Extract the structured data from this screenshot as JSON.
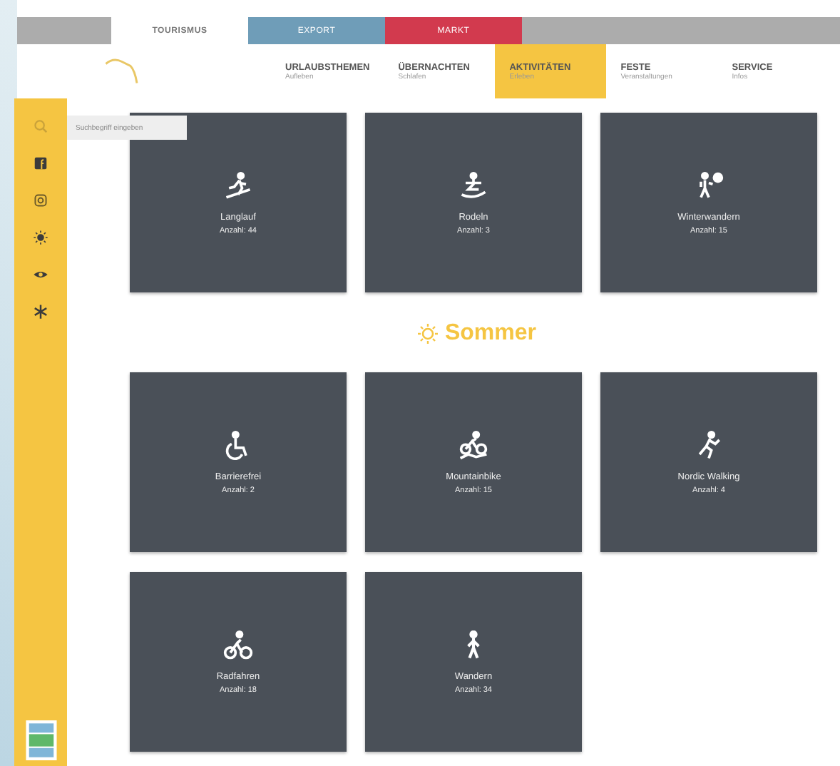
{
  "top_tabs": [
    {
      "label": "TOURISMUS",
      "selected": true,
      "color": "#ffffff"
    },
    {
      "label": "EXPORT",
      "selected": false,
      "color": "#6f9db8"
    },
    {
      "label": "MARKT",
      "selected": false,
      "color": "#d23a4e"
    }
  ],
  "nav": [
    {
      "label": "URLAUBSTHEMEN",
      "sub": "Aufleben",
      "selected": false
    },
    {
      "label": "ÜBERNACHTEN",
      "sub": "Schlafen",
      "selected": false
    },
    {
      "label": "AKTIVITÄTEN",
      "sub": "Erleben",
      "selected": true
    },
    {
      "label": "FESTE",
      "sub": "Veranstaltungen",
      "selected": false
    },
    {
      "label": "SERVICE",
      "sub": "Infos",
      "selected": false
    }
  ],
  "sidebar": [
    {
      "kind": "search"
    },
    {
      "kind": "facebook"
    },
    {
      "kind": "instagram"
    },
    {
      "kind": "sun"
    },
    {
      "kind": "eye"
    },
    {
      "kind": "snowflake"
    }
  ],
  "search": {
    "placeholder": "Suchbegriff eingeben"
  },
  "winter": [
    {
      "title": "Langlauf",
      "count": "Anzahl: 44",
      "kind": "ski"
    },
    {
      "title": "Rodeln",
      "count": "Anzahl: 3",
      "kind": "sled"
    },
    {
      "title": "Winterwandern",
      "count": "Anzahl: 15",
      "kind": "hike"
    }
  ],
  "summer_heading": "Sommer",
  "summer": [
    {
      "title": "Barrierefrei",
      "count": "Anzahl: 2",
      "kind": "wheelchair"
    },
    {
      "title": "Mountainbike",
      "count": "Anzahl: 15",
      "kind": "mtb"
    },
    {
      "title": "Nordic Walking",
      "count": "Anzahl: 4",
      "kind": "run"
    },
    {
      "title": "Radfahren",
      "count": "Anzahl: 18",
      "kind": "bike"
    },
    {
      "title": "Wandern",
      "count": "Anzahl: 34",
      "kind": "walk"
    }
  ]
}
